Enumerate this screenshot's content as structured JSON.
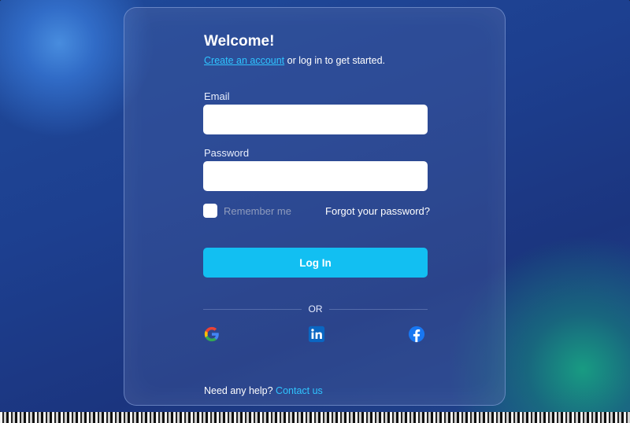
{
  "login": {
    "title": "Welcome!",
    "create_account_link": "Create an account",
    "subtitle_rest": " or log in to get started.",
    "email_label": "Email",
    "email_value": "",
    "password_label": "Password",
    "password_value": "",
    "remember_label": "Remember me",
    "remember_checked": false,
    "forgot_link": "Forgot your password?",
    "login_button": "Log In",
    "divider_text": "OR",
    "social": [
      {
        "icon": "google-icon"
      },
      {
        "icon": "linkedin-icon"
      },
      {
        "icon": "facebook-icon"
      }
    ],
    "help_text": "Need any help? ",
    "contact_link": "Contact us"
  },
  "colors": {
    "accent": "#12BFF2",
    "link": "#2FC4FF",
    "background": "#1D3F8F"
  }
}
